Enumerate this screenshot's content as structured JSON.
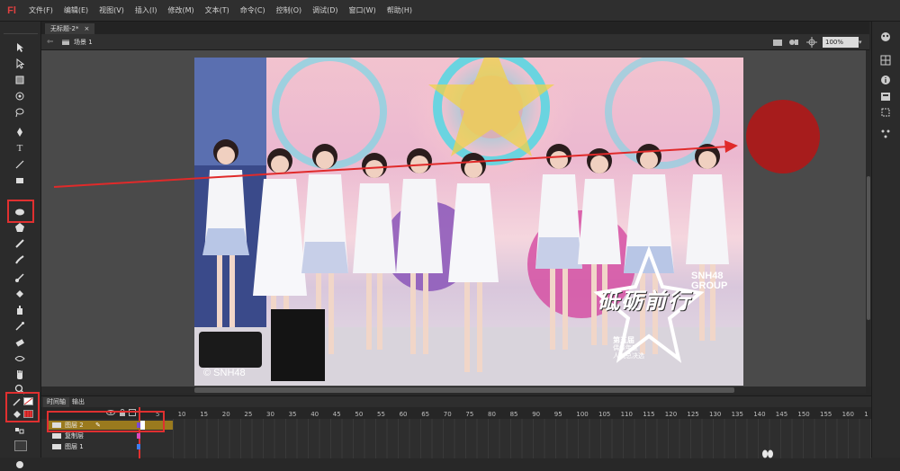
{
  "app": {
    "logo": "Fl"
  },
  "menu": {
    "items": [
      "文件(F)",
      "编辑(E)",
      "视图(V)",
      "插入(I)",
      "修改(M)",
      "文本(T)",
      "命令(C)",
      "控制(O)",
      "调试(D)",
      "窗口(W)",
      "帮助(H)"
    ]
  },
  "document": {
    "tab_label": "无标题-2*",
    "close": "×"
  },
  "editbar": {
    "scene_label": "场景 1",
    "zoom": "100%"
  },
  "photo": {
    "watermark": "© SNH48",
    "logo_main": "砥砺前行",
    "logo_group": "SNH48 GROUP",
    "logo_sub1": "第五届",
    "logo_sub2": "偶像年度",
    "logo_sub3": "人气总决选"
  },
  "timeline": {
    "tab_timeline": "时间轴",
    "tab_output": "输出",
    "frame_numbers": [
      "5",
      "10",
      "15",
      "20",
      "25",
      "30",
      "35",
      "40",
      "45",
      "50",
      "55",
      "60",
      "65",
      "70",
      "75",
      "80",
      "85",
      "90",
      "95",
      "100",
      "105",
      "110",
      "115",
      "120",
      "125",
      "130",
      "135",
      "140",
      "145",
      "150",
      "155",
      "160",
      "1"
    ],
    "layers": [
      "图层 2",
      "复制层",
      "图层 1"
    ]
  },
  "colors": {
    "highlight_red": "#e03030",
    "circle_red": "#a71c1c",
    "selected_layer": "#9a7a1e",
    "stage_bg": "#4a4a4a"
  }
}
